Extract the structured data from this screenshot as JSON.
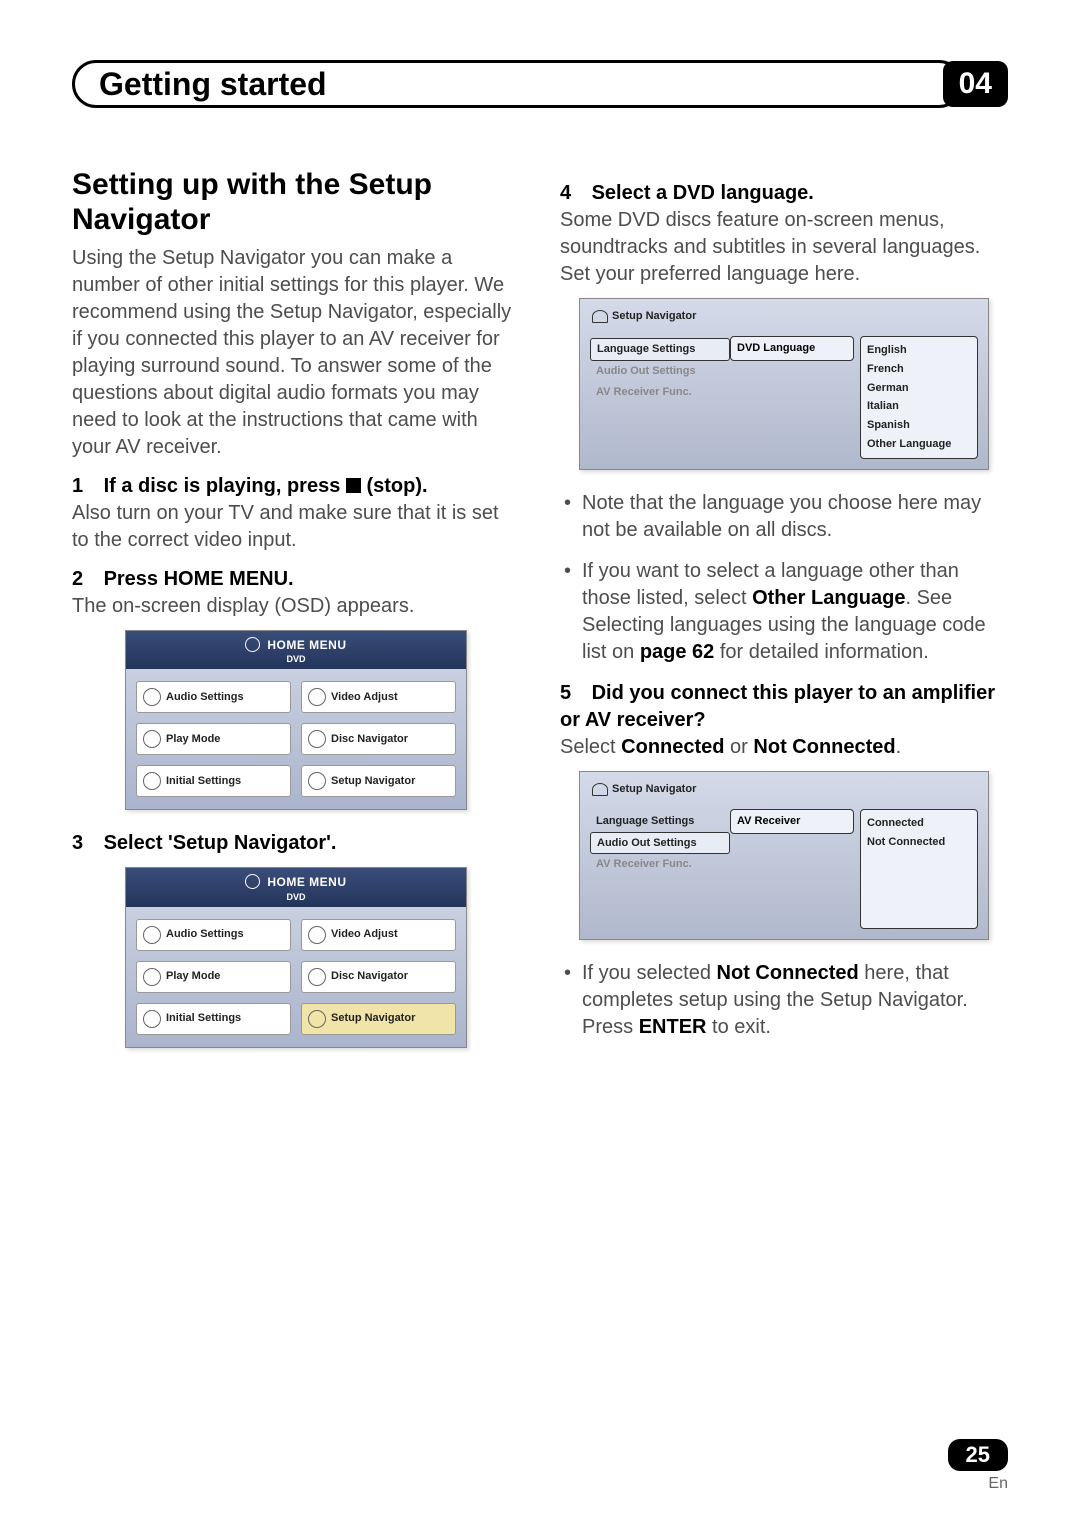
{
  "header": {
    "title": "Getting started",
    "chapter": "04"
  },
  "left": {
    "section_title": "Setting up with the Setup Navigator",
    "intro": "Using the Setup Navigator you can make a number of other initial settings for this player. We recommend using the Setup Navigator, especially if you connected this player to an AV receiver for playing surround sound. To answer some of the questions about digital audio formats you may need to look at the instructions that came with your AV receiver.",
    "step1_num": "1",
    "step1_title": "If a disc is playing, press",
    "step1_title_after": "(stop).",
    "step1_body": "Also turn on your TV and make sure that it is set to the correct video input.",
    "step2_num": "2",
    "step2_title": "Press HOME MENU.",
    "step2_body": "The on-screen display (OSD) appears.",
    "step3_num": "3",
    "step3_title": "Select 'Setup Navigator'."
  },
  "homemenu": {
    "title": "HOME MENU",
    "sub": "DVD",
    "items": [
      "Audio Settings",
      "Video Adjust",
      "Play Mode",
      "Disc Navigator",
      "Initial Settings",
      "Setup Navigator"
    ]
  },
  "right": {
    "step4_num": "4",
    "step4_title": "Select a DVD language.",
    "step4_body": "Some DVD discs feature on-screen menus, soundtracks and subtitles in several languages. Set your preferred language here.",
    "bullet1": "Note that the language you choose here may not be available on all discs.",
    "bullet2a": "If you want to select a language other than those listed, select ",
    "bullet2b": "Other Language",
    "bullet2c": ". See Selecting languages using the language code list on ",
    "bullet2d": "page 62",
    "bullet2e": " for detailed information.",
    "step5_num": "5",
    "step5_title": "Did you connect this player to an amplifier or AV receiver?",
    "step5_body_a": "Select ",
    "step5_body_b": "Connected",
    "step5_body_c": " or ",
    "step5_body_d": "Not Connected",
    "step5_body_e": ".",
    "bullet3a": "If you selected ",
    "bullet3b": "Not Connected",
    "bullet3c": " here, that completes setup using the Setup Navigator. Press ",
    "bullet3d": "ENTER",
    "bullet3e": " to exit."
  },
  "navfig": {
    "title": "Setup Navigator",
    "left_items": [
      "Language Settings",
      "Audio Out Settings",
      "AV Receiver Func."
    ],
    "fig1_mid": "DVD Language",
    "fig1_right": [
      "English",
      "French",
      "German",
      "Italian",
      "Spanish",
      "Other Language"
    ],
    "fig2_mid": "AV Receiver",
    "fig2_right": [
      "Connected",
      "Not Connected"
    ]
  },
  "footer": {
    "page": "25",
    "lang": "En"
  }
}
